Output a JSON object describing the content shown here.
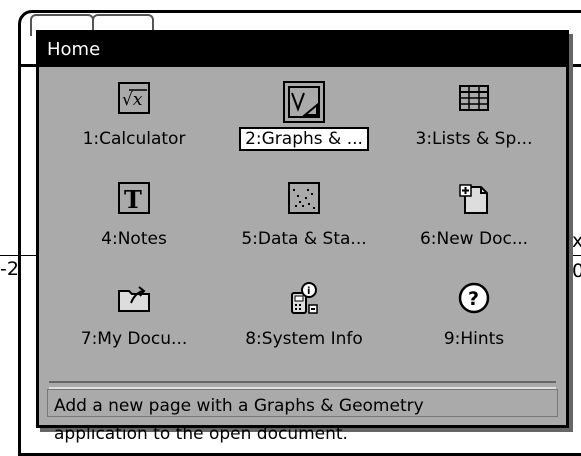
{
  "dialog": {
    "title": "Home"
  },
  "apps": [
    {
      "label": "1:Calculator",
      "icon": "calculator-icon"
    },
    {
      "label": "2:Graphs & ...",
      "icon": "graphs-icon",
      "selected": true
    },
    {
      "label": "3:Lists & Sp...",
      "icon": "spreadsheet-icon"
    },
    {
      "label": "4:Notes",
      "icon": "notes-icon"
    },
    {
      "label": "5:Data & Sta...",
      "icon": "data-stats-icon"
    },
    {
      "label": "6:New Doc...",
      "icon": "new-document-icon"
    },
    {
      "label": "7:My Docu...",
      "icon": "folder-icon"
    },
    {
      "label": "8:System Info",
      "icon": "system-info-icon"
    },
    {
      "label": "9:Hints",
      "icon": "help-icon"
    }
  ],
  "description": {
    "line1": "Add a new page with a Graphs & Geometry",
    "line2": "application to the open document."
  },
  "background": {
    "left_tick": "-2",
    "right_char_1": "x",
    "right_char_2": "0"
  }
}
